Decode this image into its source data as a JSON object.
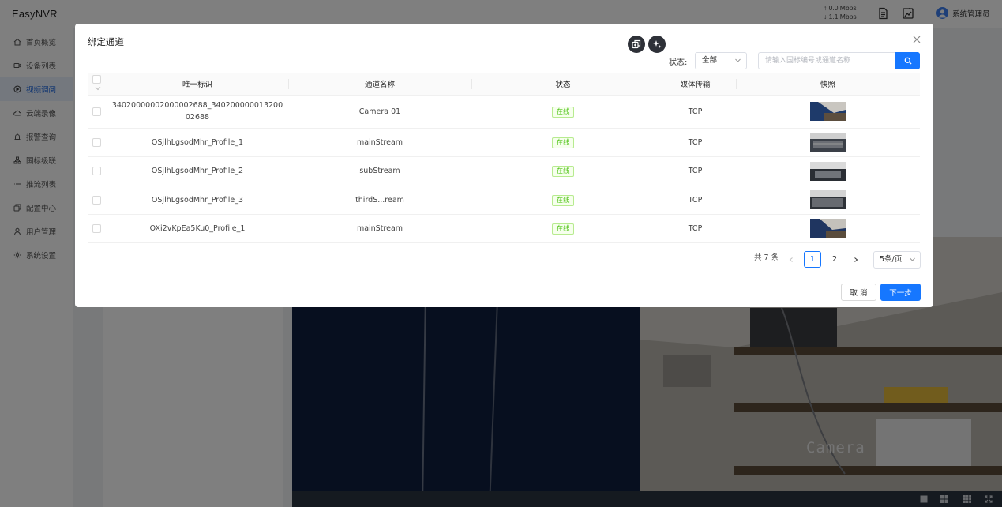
{
  "app": {
    "title": "EasyNVR",
    "net_up": "↑ 0.0 Mbps",
    "net_down": "↓ 1.1 Mbps",
    "user_name": "系统管理员"
  },
  "sidebar": {
    "items": [
      {
        "label": "首页概览",
        "icon": "home-icon"
      },
      {
        "label": "设备列表",
        "icon": "camera-icon"
      },
      {
        "label": "视频调阅",
        "icon": "play-circle-icon",
        "active": true
      },
      {
        "label": "云端录像",
        "icon": "cloud-icon"
      },
      {
        "label": "报警查询",
        "icon": "alarm-icon"
      },
      {
        "label": "国标级联",
        "icon": "cascade-icon"
      },
      {
        "label": "推流列表",
        "icon": "list-icon"
      },
      {
        "label": "配置中心",
        "icon": "config-icon"
      },
      {
        "label": "用户管理",
        "icon": "user-icon"
      },
      {
        "label": "系统设置",
        "icon": "gear-icon"
      }
    ]
  },
  "player": {
    "osd_text": "Camera 01"
  },
  "modal": {
    "title": "绑定通道",
    "filter": {
      "status_label": "状态:",
      "status_value": "全部",
      "search_placeholder": "请输入国标编号或通道名称"
    },
    "table": {
      "columns": [
        "唯一标识",
        "通道名称",
        "状态",
        "媒体传输",
        "快照"
      ],
      "rows": [
        {
          "id": "34020000002000002688_34020000001320002688",
          "name": "Camera 01",
          "status": "在线",
          "transport": "TCP"
        },
        {
          "id": "OSjlhLgsodMhr_Profile_1",
          "name": "mainStream",
          "status": "在线",
          "transport": "TCP"
        },
        {
          "id": "OSjlhLgsodMhr_Profile_2",
          "name": "subStream",
          "status": "在线",
          "transport": "TCP"
        },
        {
          "id": "OSjlhLgsodMhr_Profile_3",
          "name": "thirdS...ream",
          "status": "在线",
          "transport": "TCP"
        },
        {
          "id": "OXi2vKpEa5Ku0_Profile_1",
          "name": "mainStream",
          "status": "在线",
          "transport": "TCP"
        }
      ]
    },
    "pagination": {
      "total": "共 7 条",
      "pages": [
        "1",
        "2"
      ],
      "current": "1",
      "page_size": "5条/页"
    },
    "buttons": {
      "cancel": "取 消",
      "next": "下一步"
    }
  },
  "colors": {
    "primary": "#1677ff",
    "online_green": "#52c41a",
    "active_nav_bg": "#e8f0fd"
  }
}
